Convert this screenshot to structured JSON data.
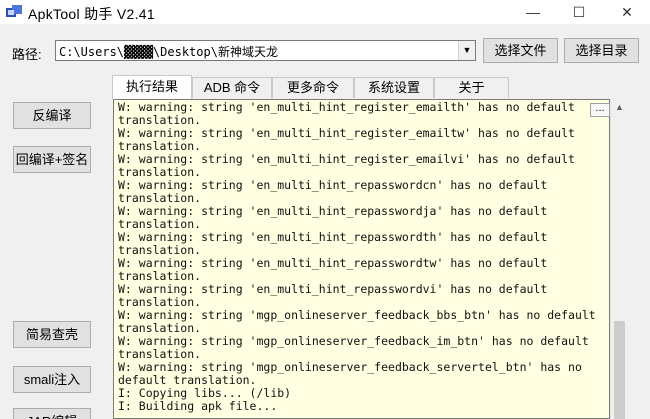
{
  "window": {
    "title": "ApkTool 助手 V2.41",
    "app_icon": "apktool-app-icon",
    "controls": {
      "minimize": "—",
      "maximize": "☐",
      "close": "✕"
    }
  },
  "path_bar": {
    "label": "路径:",
    "value": "C:\\Users\\▓▓▓▓\\Desktop\\新神域天龙",
    "dropdown_icon": "chevron-down-icon",
    "choose_file_label": "选择文件",
    "choose_dir_label": "选择目录"
  },
  "tabs": [
    {
      "label": "执行结果",
      "active": true
    },
    {
      "label": "ADB 命令",
      "active": false
    },
    {
      "label": "更多命令",
      "active": false
    },
    {
      "label": "系统设置",
      "active": false
    },
    {
      "label": "关于",
      "active": false
    }
  ],
  "side_buttons": {
    "decompile": "反编译",
    "recompile_sign": "回编译+签名",
    "simple_check": "简易查壳",
    "smali_inject": "smali注入",
    "partial": "JAR编辑"
  },
  "output": {
    "ellipsis_label": "...",
    "lines": [
      "W: warning: string 'en_multi_hint_register_emailth' has no default",
      "translation.",
      "W: warning: string 'en_multi_hint_register_emailtw' has no default",
      "translation.",
      "W: warning: string 'en_multi_hint_register_emailvi' has no default",
      "translation.",
      "W: warning: string 'en_multi_hint_repasswordcn' has no default",
      "translation.",
      "W: warning: string 'en_multi_hint_repasswordja' has no default",
      "translation.",
      "W: warning: string 'en_multi_hint_repasswordth' has no default",
      "translation.",
      "W: warning: string 'en_multi_hint_repasswordtw' has no default",
      "translation.",
      "W: warning: string 'en_multi_hint_repasswordvi' has no default",
      "translation.",
      "W: warning: string 'mgp_onlineserver_feedback_bbs_btn' has no default",
      "translation.",
      "W: warning: string 'mgp_onlineserver_feedback_im_btn' has no default",
      "translation.",
      "W: warning: string 'mgp_onlineserver_feedback_servertel_btn' has no",
      "default translation.",
      "I: Copying libs... (/lib)",
      "I: Building apk file..."
    ]
  },
  "scrollbar": {
    "up_icon": "scroll-up-arrow-icon",
    "position": 0.95
  }
}
